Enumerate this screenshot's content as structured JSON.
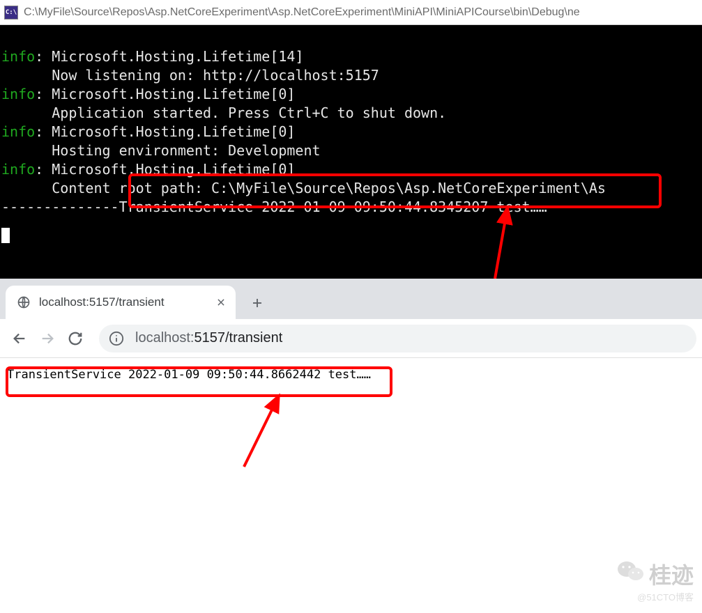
{
  "console": {
    "icon_label": "C:\\",
    "title": "C:\\MyFile\\Source\\Repos\\Asp.NetCoreExperiment\\Asp.NetCoreExperiment\\MiniAPI\\MiniAPICourse\\bin\\Debug\\ne",
    "lines": [
      {
        "prefix": "info",
        "text": ": Microsoft.Hosting.Lifetime[14]"
      },
      {
        "prefix": "",
        "text": "      Now listening on: http://localhost:5157"
      },
      {
        "prefix": "info",
        "text": ": Microsoft.Hosting.Lifetime[0]"
      },
      {
        "prefix": "",
        "text": "      Application started. Press Ctrl+C to shut down."
      },
      {
        "prefix": "info",
        "text": ": Microsoft.Hosting.Lifetime[0]"
      },
      {
        "prefix": "",
        "text": "      Hosting environment: Development"
      },
      {
        "prefix": "info",
        "text": ": Microsoft.Hosting.Lifetime[0]"
      },
      {
        "prefix": "",
        "text": "      Content root path: C:\\MyFile\\Source\\Repos\\Asp.NetCoreExperiment\\As"
      }
    ],
    "highlighted_line": "--------------TransientService 2022-01-09 09:50:44.8345207 test……"
  },
  "browser": {
    "tab_title": "localhost:5157/transient",
    "address_host": "localhost:",
    "address_path": "5157/transient",
    "page_text": "TransientService 2022-01-09 09:50:44.8662442 test……"
  },
  "watermark": {
    "main": "桂迹",
    "sub": "@51CTO博客"
  }
}
